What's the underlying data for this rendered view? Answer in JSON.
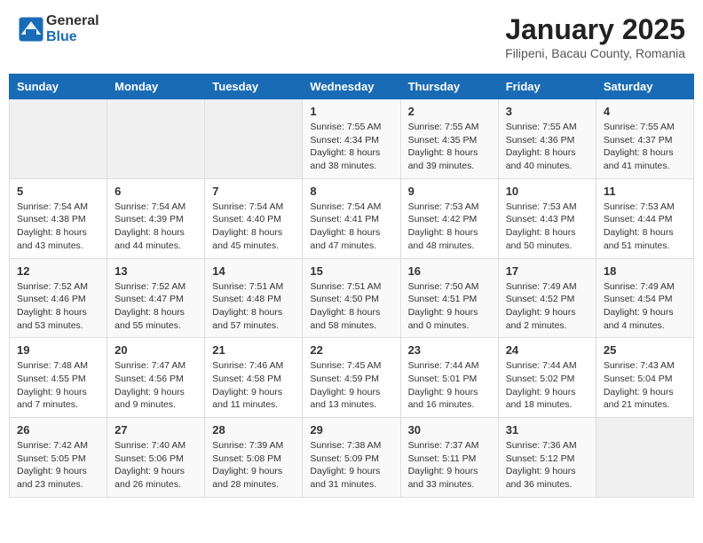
{
  "header": {
    "logo_general": "General",
    "logo_blue": "Blue",
    "month": "January 2025",
    "location": "Filipeni, Bacau County, Romania"
  },
  "weekdays": [
    "Sunday",
    "Monday",
    "Tuesday",
    "Wednesday",
    "Thursday",
    "Friday",
    "Saturday"
  ],
  "weeks": [
    [
      {
        "day": "",
        "info": ""
      },
      {
        "day": "",
        "info": ""
      },
      {
        "day": "",
        "info": ""
      },
      {
        "day": "1",
        "info": "Sunrise: 7:55 AM\nSunset: 4:34 PM\nDaylight: 8 hours and 38 minutes."
      },
      {
        "day": "2",
        "info": "Sunrise: 7:55 AM\nSunset: 4:35 PM\nDaylight: 8 hours and 39 minutes."
      },
      {
        "day": "3",
        "info": "Sunrise: 7:55 AM\nSunset: 4:36 PM\nDaylight: 8 hours and 40 minutes."
      },
      {
        "day": "4",
        "info": "Sunrise: 7:55 AM\nSunset: 4:37 PM\nDaylight: 8 hours and 41 minutes."
      }
    ],
    [
      {
        "day": "5",
        "info": "Sunrise: 7:54 AM\nSunset: 4:38 PM\nDaylight: 8 hours and 43 minutes."
      },
      {
        "day": "6",
        "info": "Sunrise: 7:54 AM\nSunset: 4:39 PM\nDaylight: 8 hours and 44 minutes."
      },
      {
        "day": "7",
        "info": "Sunrise: 7:54 AM\nSunset: 4:40 PM\nDaylight: 8 hours and 45 minutes."
      },
      {
        "day": "8",
        "info": "Sunrise: 7:54 AM\nSunset: 4:41 PM\nDaylight: 8 hours and 47 minutes."
      },
      {
        "day": "9",
        "info": "Sunrise: 7:53 AM\nSunset: 4:42 PM\nDaylight: 8 hours and 48 minutes."
      },
      {
        "day": "10",
        "info": "Sunrise: 7:53 AM\nSunset: 4:43 PM\nDaylight: 8 hours and 50 minutes."
      },
      {
        "day": "11",
        "info": "Sunrise: 7:53 AM\nSunset: 4:44 PM\nDaylight: 8 hours and 51 minutes."
      }
    ],
    [
      {
        "day": "12",
        "info": "Sunrise: 7:52 AM\nSunset: 4:46 PM\nDaylight: 8 hours and 53 minutes."
      },
      {
        "day": "13",
        "info": "Sunrise: 7:52 AM\nSunset: 4:47 PM\nDaylight: 8 hours and 55 minutes."
      },
      {
        "day": "14",
        "info": "Sunrise: 7:51 AM\nSunset: 4:48 PM\nDaylight: 8 hours and 57 minutes."
      },
      {
        "day": "15",
        "info": "Sunrise: 7:51 AM\nSunset: 4:50 PM\nDaylight: 8 hours and 58 minutes."
      },
      {
        "day": "16",
        "info": "Sunrise: 7:50 AM\nSunset: 4:51 PM\nDaylight: 9 hours and 0 minutes."
      },
      {
        "day": "17",
        "info": "Sunrise: 7:49 AM\nSunset: 4:52 PM\nDaylight: 9 hours and 2 minutes."
      },
      {
        "day": "18",
        "info": "Sunrise: 7:49 AM\nSunset: 4:54 PM\nDaylight: 9 hours and 4 minutes."
      }
    ],
    [
      {
        "day": "19",
        "info": "Sunrise: 7:48 AM\nSunset: 4:55 PM\nDaylight: 9 hours and 7 minutes."
      },
      {
        "day": "20",
        "info": "Sunrise: 7:47 AM\nSunset: 4:56 PM\nDaylight: 9 hours and 9 minutes."
      },
      {
        "day": "21",
        "info": "Sunrise: 7:46 AM\nSunset: 4:58 PM\nDaylight: 9 hours and 11 minutes."
      },
      {
        "day": "22",
        "info": "Sunrise: 7:45 AM\nSunset: 4:59 PM\nDaylight: 9 hours and 13 minutes."
      },
      {
        "day": "23",
        "info": "Sunrise: 7:44 AM\nSunset: 5:01 PM\nDaylight: 9 hours and 16 minutes."
      },
      {
        "day": "24",
        "info": "Sunrise: 7:44 AM\nSunset: 5:02 PM\nDaylight: 9 hours and 18 minutes."
      },
      {
        "day": "25",
        "info": "Sunrise: 7:43 AM\nSunset: 5:04 PM\nDaylight: 9 hours and 21 minutes."
      }
    ],
    [
      {
        "day": "26",
        "info": "Sunrise: 7:42 AM\nSunset: 5:05 PM\nDaylight: 9 hours and 23 minutes."
      },
      {
        "day": "27",
        "info": "Sunrise: 7:40 AM\nSunset: 5:06 PM\nDaylight: 9 hours and 26 minutes."
      },
      {
        "day": "28",
        "info": "Sunrise: 7:39 AM\nSunset: 5:08 PM\nDaylight: 9 hours and 28 minutes."
      },
      {
        "day": "29",
        "info": "Sunrise: 7:38 AM\nSunset: 5:09 PM\nDaylight: 9 hours and 31 minutes."
      },
      {
        "day": "30",
        "info": "Sunrise: 7:37 AM\nSunset: 5:11 PM\nDaylight: 9 hours and 33 minutes."
      },
      {
        "day": "31",
        "info": "Sunrise: 7:36 AM\nSunset: 5:12 PM\nDaylight: 9 hours and 36 minutes."
      },
      {
        "day": "",
        "info": ""
      }
    ]
  ]
}
